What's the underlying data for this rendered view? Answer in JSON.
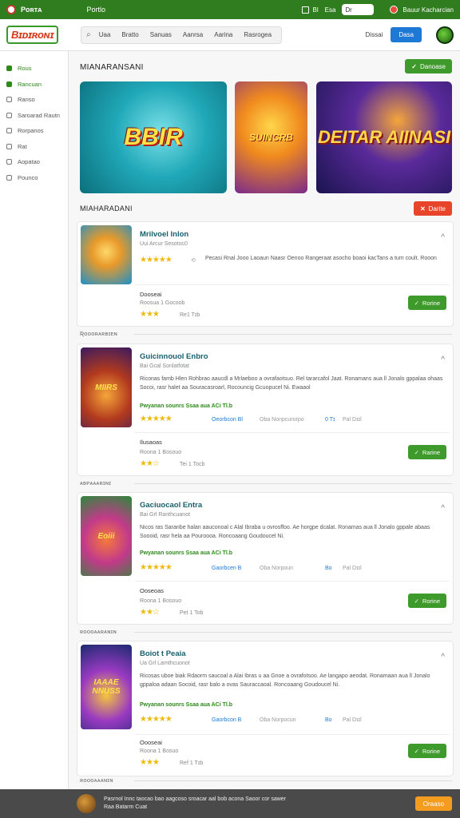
{
  "topbar": {
    "brand": "Pᴏʀᴛᴀ",
    "link": "Portlo",
    "icon_label_1": "Bl",
    "icon_label_2": "Esa",
    "search_value": "Dr",
    "user": "Bauur Kacharcian"
  },
  "header": {
    "logo": "Bɪᴅɪʀᴏɴɪ",
    "search_icon": "⌕",
    "nav": [
      "Uaa",
      "Bratto",
      "Sanuas",
      "Aanrsa",
      "Aarina",
      "Rasrogea"
    ],
    "link": "Dissai",
    "button": "Dasa"
  },
  "sidebar": {
    "items": [
      {
        "label": "Rous",
        "active": true
      },
      {
        "label": "Rancuan",
        "active": true
      },
      {
        "label": "Ranso",
        "active": false
      },
      {
        "label": "Saroarad Rautn",
        "active": false
      },
      {
        "label": "Rorpanos",
        "active": false
      },
      {
        "label": "Rat",
        "active": false
      },
      {
        "label": "Aopatao",
        "active": false
      },
      {
        "label": "Pounco",
        "active": false
      }
    ]
  },
  "featured": {
    "title": "MIANARANSANI",
    "button": "Danoase",
    "banners": [
      {
        "text": "BBIR"
      },
      {
        "text": "SUINCRB"
      },
      {
        "text": "DEITAR AIINASI"
      }
    ]
  },
  "list": {
    "title": "MIAHARADANI",
    "button": "Darite"
  },
  "cards": [
    {
      "thumb": "",
      "title": "Mrilvoel Inlon",
      "sub": "Uui Arcur Sesotoc0",
      "desc": "Pecasi Rnal Jooo Laoaun Naasr Oenoo Rangeraat asocho boaoi kacTans a tum coult. Rooon",
      "promo": "",
      "meta_blue": "",
      "meta_2": "",
      "meta_3": "",
      "meta_4": "",
      "footer_label": "Dooseai",
      "footer_sub": "Roosua   1 Gocoob",
      "footer_meta": "Re1 Tɪb",
      "button": "Rorine"
    },
    {
      "thumb": "MIIRS",
      "title": "Guicinnouol Enbro",
      "sub": "Bai Gcal Sonlatfotat",
      "desc": "Riconas famb Hlen Rohbrao aaucdl a Mrlaeboo a ovrafaotsuo. Rel tararcafol Jaat. Ronamans aua ll Jonalo gppalaa ohaas Socoi, rasr halet aa Souracasroarl, Rocouncig Gcuopucel Ni. Ewaaol",
      "promo": "Pwyanan sounrs Ssaa aua ACi Tl.b",
      "meta_blue": "Oeorbcon Bl",
      "meta_2": "Oba Nonpcurorpo",
      "meta_3": "0 Tɪ",
      "meta_4": "Pal Dɪɪl",
      "footer_label": "Ilusaoas",
      "footer_sub": "Roona   1 Bosouo",
      "footer_meta": "Tei 1 Tocb",
      "button": "Rarine"
    },
    {
      "thumb": "Eoiii",
      "title": "Gaciuocaol Entra",
      "sub": "Bai Grl Ranthcuanot",
      "desc": "Nicos ras Saranbe halan aauconoal c Alal Ibraba u ovrosffoo. Ae horgpe dcalat. Ronamas aua ll Jonalo gppale abaas Soooid, rasr hela aa Pouroooa. Roncoaang Goudoucel Ni.",
      "promo": "Pwyanan sounrs Ssaa aua ACi Tl.b",
      "meta_blue": "Gaorbcen B",
      "meta_2": "Oba Norpoun",
      "meta_3": "Bo",
      "meta_4": "Pal Dɪɪl",
      "footer_label": "Ooseoas",
      "footer_sub": "Roona   1 Bosouo",
      "footer_meta": "Pet 1 Tob",
      "button": "Rorine"
    },
    {
      "thumb": "IAAAE NNUSS",
      "title": "Boiot t Peaia",
      "sub": "Ua Grl Lamthcuonot",
      "desc": "Ricosas uboe biak Rdaorm saucoal a Alai Ibras u aa Gnoe a ovrafotsoo. Ae langapo aeodat. Ronamaan aua ll Jonalo gppaloa adaan Socoid, rasr balo a ovas Sauraccaoal. Roncoaang Goudoucel Ni.",
      "promo": "Pwyanan sounrs Ssaa aua ACi Tl.b",
      "meta_blue": "Gaorbcon B",
      "meta_2": "Oba Norpocun",
      "meta_3": "Bo",
      "meta_4": "Pal Dɪɪl",
      "footer_label": "Oooseai",
      "footer_sub": "Roona   1 Bosuo",
      "footer_meta": "Ref 1 Tɪb",
      "button": "Rorine"
    }
  ],
  "group_labels": [
    "Ʀoooʀᴀʀʙɪᴇɴ",
    "ᴀʙᴘᴀᴀᴀʀɪɴɪ",
    "ʀoooᴀᴀʀᴀɴɪɴ",
    "ʀoooᴀᴀᴀɴɪɴ"
  ],
  "cookie": {
    "text_1": "Pasrnol Innc taocao bao aagcoso sroacar aal bob acona Saoor cor sawer",
    "text_2": "Raa Batarm Cuat",
    "button": "Oraaso"
  },
  "colors": {
    "brand_green": "#2f7d1e",
    "action_green": "#3f9a2c",
    "alert_red": "#e8442a",
    "accent_blue": "#1e78d6",
    "star": "#f0b90b",
    "cookie_button": "#f39c1f"
  }
}
